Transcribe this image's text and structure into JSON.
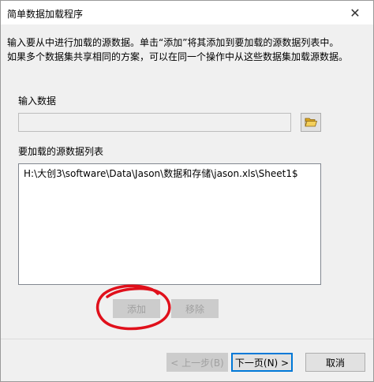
{
  "window": {
    "title": "简单数据加载程序",
    "close_glyph": "✕"
  },
  "description": {
    "line1": "输入要从中进行加载的源数据。单击“添加”将其添加到要加载的源数据列表中。",
    "line2": "如果多个数据集共享相同的方案，可以在同一个操作中从这些数据集加载源数据。"
  },
  "input": {
    "label": "输入数据",
    "value": ""
  },
  "source_list": {
    "label": "要加载的源数据列表",
    "items": [
      "H:\\大创3\\software\\Data\\Jason\\数据和存储\\jason.xls\\Sheet1$"
    ]
  },
  "buttons": {
    "add": "添加",
    "remove": "移除",
    "back": "< 上一步(B)",
    "next": "下一页(N) >",
    "cancel": "取消"
  },
  "colors": {
    "annotation": "#e0101b",
    "focus": "#0078d7"
  }
}
